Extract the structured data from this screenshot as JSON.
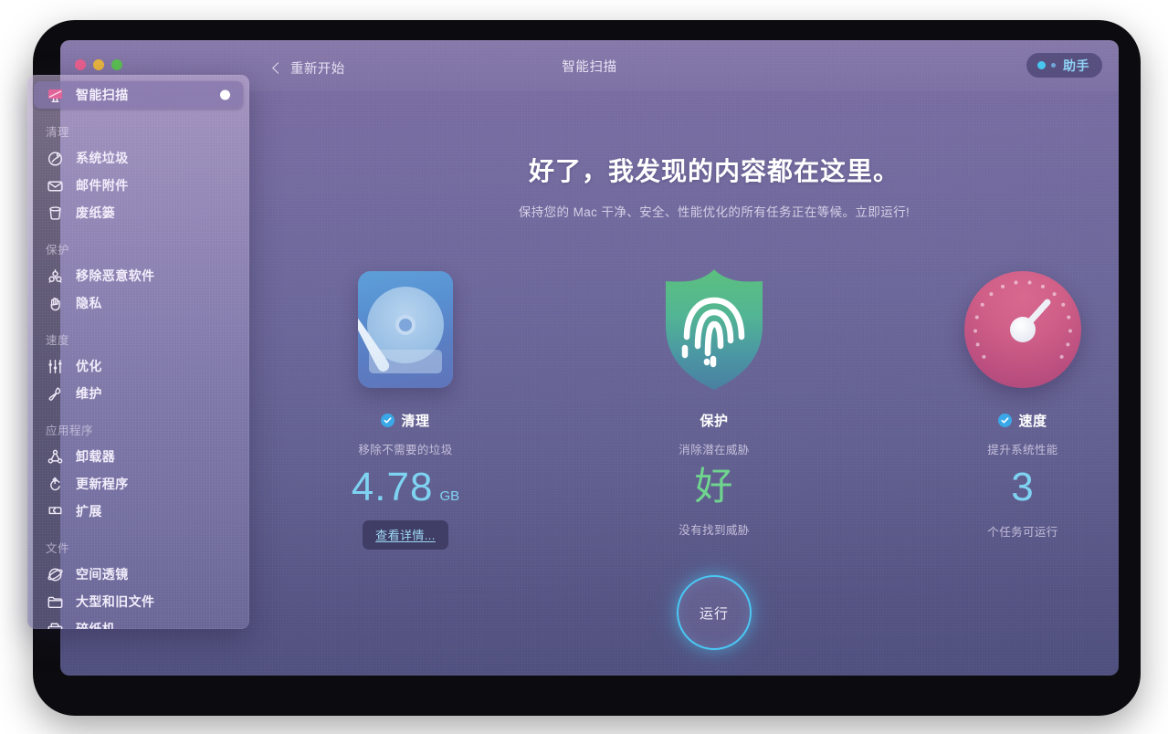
{
  "window": {
    "title": "智能扫描",
    "back_label": "重新开始",
    "assistant_label": "助手",
    "traffic_lights": [
      "close-red",
      "minimize-yellow",
      "maximize-green"
    ],
    "accent_blue": "#4bc8f5",
    "accent_green": "#6fd48e",
    "accent_pink": "#cf5f87"
  },
  "sidebar": {
    "active": {
      "label": "智能扫描",
      "icon": "monitor-scan-icon",
      "status_dot": true
    },
    "groups": [
      {
        "label": "清理",
        "items": [
          {
            "label": "系统垃圾",
            "icon": "broom-circle-icon"
          },
          {
            "label": "邮件附件",
            "icon": "envelope-icon"
          },
          {
            "label": "废纸篓",
            "icon": "trash-bin-icon"
          }
        ]
      },
      {
        "label": "保护",
        "items": [
          {
            "label": "移除恶意软件",
            "icon": "biohazard-icon"
          },
          {
            "label": "隐私",
            "icon": "hand-icon"
          }
        ]
      },
      {
        "label": "速度",
        "items": [
          {
            "label": "优化",
            "icon": "sliders-icon"
          },
          {
            "label": "维护",
            "icon": "wrench-icon"
          }
        ]
      },
      {
        "label": "应用程序",
        "items": [
          {
            "label": "卸载器",
            "icon": "uninstaller-icon"
          },
          {
            "label": "更新程序",
            "icon": "refresh-arrow-icon"
          },
          {
            "label": "扩展",
            "icon": "puzzle-piece-icon"
          }
        ]
      },
      {
        "label": "文件",
        "items": [
          {
            "label": "空间透镜",
            "icon": "space-lens-icon"
          },
          {
            "label": "大型和旧文件",
            "icon": "folder-icon"
          },
          {
            "label": "碎纸机",
            "icon": "shredder-icon"
          }
        ]
      }
    ]
  },
  "main": {
    "headline": "好了，我发现的内容都在这里。",
    "subhead": "保持您的 Mac 干净、安全、性能优化的所有任务正在等候。立即运行!",
    "cards": [
      {
        "id": "clean",
        "title": "清理",
        "has_check": true,
        "subtitle": "移除不需要的垃圾",
        "value": "4.78",
        "unit": "GB",
        "value_color": "#7fd3f2",
        "footer": "",
        "button": "查看详情...",
        "art": "hard-drive-icon"
      },
      {
        "id": "protect",
        "title": "保护",
        "has_check": false,
        "subtitle": "消除潜在威胁",
        "value": "好",
        "unit": "",
        "value_color": "#6fd48e",
        "footer": "没有找到威胁",
        "button": "",
        "art": "shield-fingerprint-icon"
      },
      {
        "id": "speed",
        "title": "速度",
        "has_check": true,
        "subtitle": "提升系统性能",
        "value": "3",
        "unit": "",
        "value_color": "#7fd3f2",
        "footer": "个任务可运行",
        "button": "",
        "art": "speed-gauge-icon"
      }
    ],
    "run_label": "运行"
  }
}
